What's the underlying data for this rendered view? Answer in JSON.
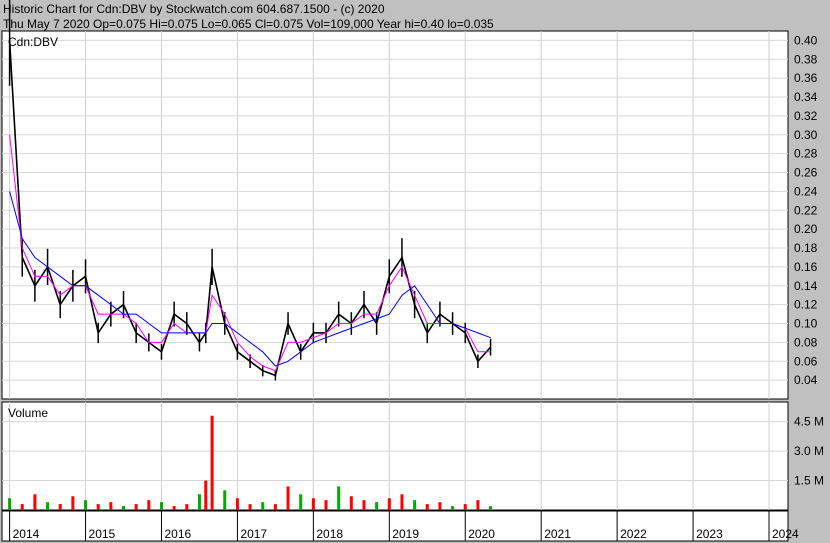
{
  "header": {
    "line1": "Historic Chart for Cdn:DBV by Stockwatch.com 604.687.1500 - (c) 2020",
    "line2": "Thu May  7 2020  Op=0.075  Hi=0.075  Lo=0.065  Cl=0.075  Vol=109,000  Year hi=0.40  lo=0.035"
  },
  "chart_data": [
    {
      "type": "line",
      "label": "Cdn:DBV",
      "x_dates": [
        "2014-01",
        "2014-03",
        "2014-05",
        "2014-07",
        "2014-09",
        "2014-11",
        "2015-01",
        "2015-03",
        "2015-05",
        "2015-07",
        "2015-09",
        "2015-11",
        "2016-01",
        "2016-03",
        "2016-05",
        "2016-07",
        "2016-08",
        "2016-09",
        "2016-11",
        "2017-01",
        "2017-03",
        "2017-05",
        "2017-07",
        "2017-09",
        "2017-11",
        "2018-01",
        "2018-03",
        "2018-05",
        "2018-07",
        "2018-09",
        "2018-11",
        "2019-01",
        "2019-03",
        "2019-05",
        "2019-07",
        "2019-09",
        "2019-11",
        "2020-01",
        "2020-03",
        "2020-05"
      ],
      "series": [
        {
          "color": "#000000",
          "values": [
            0.4,
            0.17,
            0.14,
            0.16,
            0.12,
            0.14,
            0.15,
            0.09,
            0.11,
            0.12,
            0.09,
            0.08,
            0.07,
            0.11,
            0.1,
            0.08,
            0.09,
            0.16,
            0.1,
            0.07,
            0.06,
            0.05,
            0.045,
            0.1,
            0.07,
            0.09,
            0.09,
            0.11,
            0.1,
            0.12,
            0.1,
            0.15,
            0.17,
            0.12,
            0.09,
            0.11,
            0.1,
            0.09,
            0.06,
            0.075
          ]
        },
        {
          "color": "#ff00ff",
          "values": [
            0.3,
            0.18,
            0.15,
            0.15,
            0.13,
            0.14,
            0.14,
            0.11,
            0.11,
            0.11,
            0.1,
            0.08,
            0.08,
            0.1,
            0.09,
            0.09,
            0.09,
            0.13,
            0.11,
            0.08,
            0.065,
            0.055,
            0.05,
            0.08,
            0.08,
            0.085,
            0.09,
            0.1,
            0.1,
            0.11,
            0.11,
            0.14,
            0.16,
            0.13,
            0.1,
            0.1,
            0.1,
            0.095,
            0.07,
            0.07
          ]
        },
        {
          "color": "#0000ff",
          "values": [
            0.24,
            0.19,
            0.17,
            0.16,
            0.15,
            0.14,
            0.14,
            0.13,
            0.12,
            0.11,
            0.11,
            0.1,
            0.09,
            0.09,
            0.09,
            0.09,
            0.09,
            0.1,
            0.1,
            0.09,
            0.08,
            0.07,
            0.055,
            0.06,
            0.07,
            0.08,
            0.085,
            0.09,
            0.095,
            0.1,
            0.105,
            0.11,
            0.13,
            0.14,
            0.12,
            0.1,
            0.1,
            0.095,
            0.09,
            0.085
          ]
        }
      ],
      "ylim": [
        0.02,
        0.41
      ],
      "yticks": [
        "0.40",
        "0.38",
        "0.36",
        "0.34",
        "0.32",
        "0.30",
        "0.28",
        "0.26",
        "0.24",
        "0.22",
        "0.20",
        "0.18",
        "0.16",
        "0.14",
        "0.12",
        "0.10",
        "0.08",
        "0.06",
        "0.04"
      ],
      "grid": true
    },
    {
      "type": "bar",
      "label": "Volume",
      "yticks": [
        "4.5 M",
        "3.0 M",
        "1.5 M"
      ],
      "values_m": [
        0.6,
        0.3,
        0.8,
        0.4,
        0.3,
        0.7,
        0.5,
        0.3,
        0.4,
        0.2,
        0.3,
        0.5,
        0.4,
        0.2,
        0.3,
        0.8,
        1.5,
        4.8,
        1.0,
        0.6,
        0.3,
        0.4,
        0.3,
        1.2,
        0.8,
        0.6,
        0.5,
        1.2,
        0.7,
        0.5,
        0.4,
        0.6,
        0.8,
        0.5,
        0.3,
        0.4,
        0.2,
        0.3,
        0.5,
        0.2
      ],
      "ylim": [
        0,
        5.5
      ]
    }
  ],
  "xaxis": {
    "labels": [
      "2014",
      "2015",
      "2016",
      "2017",
      "2018",
      "2019",
      "2020",
      "2021",
      "2022",
      "2023",
      "2024"
    ]
  }
}
